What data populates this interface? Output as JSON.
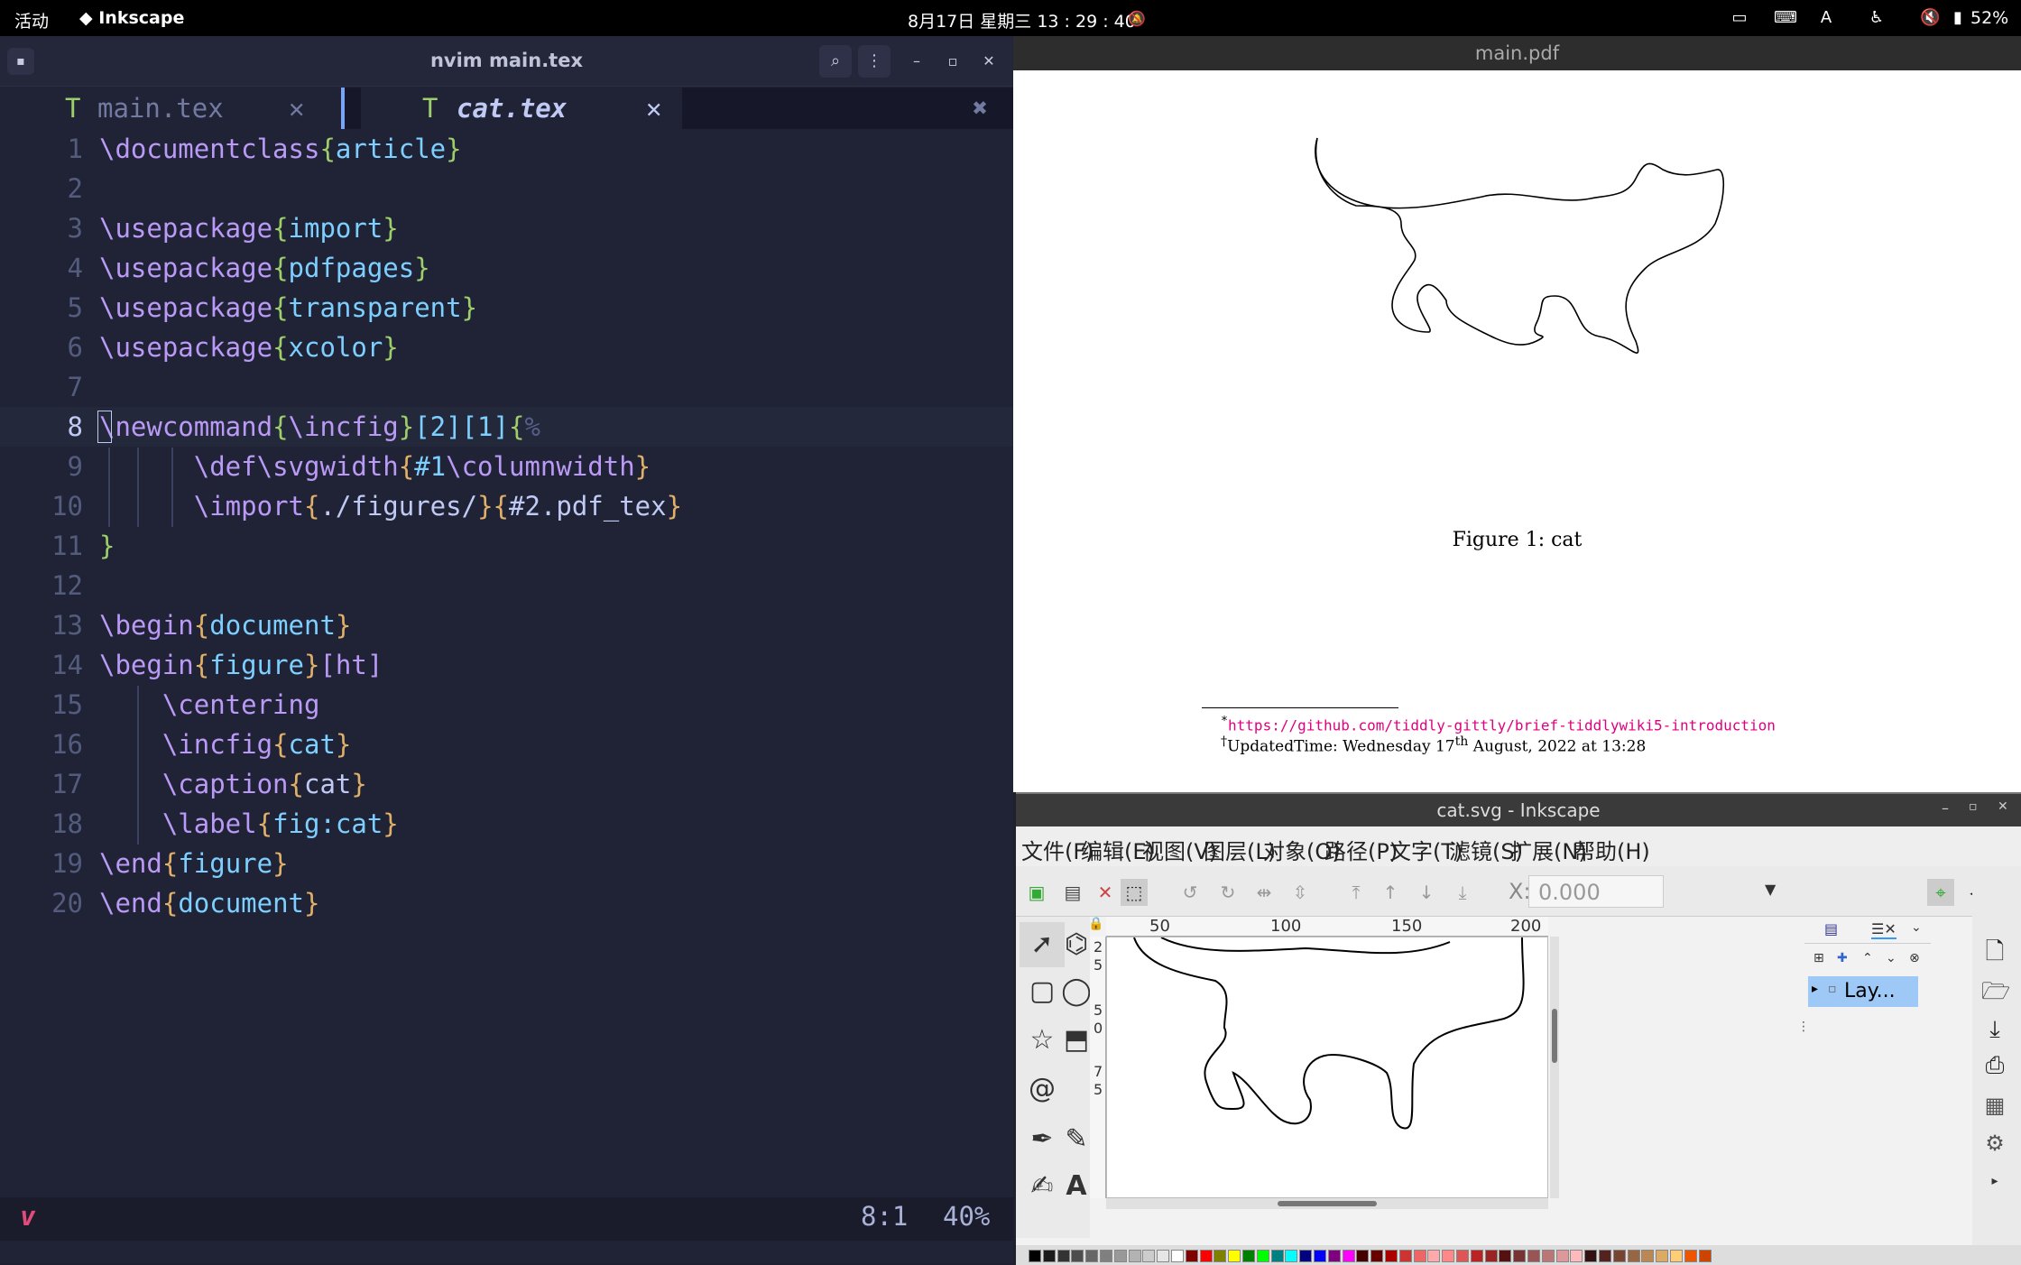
{
  "topbar": {
    "activities": "活动",
    "app": "Inkscape",
    "clock": "8月17日 星期三 13 : 29 : 40",
    "battery": "52%"
  },
  "nvim": {
    "title": "nvim main.tex",
    "tabs": [
      {
        "icon": "T",
        "label": "main.tex",
        "close": "✕"
      },
      {
        "icon": "T",
        "label": "cat.tex",
        "close": "✕"
      }
    ],
    "tab_close_all": "✖",
    "lines": [
      {
        "n": "1",
        "parts": [
          [
            "cmd",
            "\\documentclass"
          ],
          [
            "br",
            "{"
          ],
          [
            "arg",
            "article"
          ],
          [
            "br",
            "}"
          ]
        ]
      },
      {
        "n": "2",
        "parts": []
      },
      {
        "n": "3",
        "parts": [
          [
            "cmd",
            "\\usepackage"
          ],
          [
            "br",
            "{"
          ],
          [
            "arg",
            "import"
          ],
          [
            "br",
            "}"
          ]
        ]
      },
      {
        "n": "4",
        "parts": [
          [
            "cmd",
            "\\usepackage"
          ],
          [
            "br",
            "{"
          ],
          [
            "arg",
            "pdfpages"
          ],
          [
            "br",
            "}"
          ]
        ]
      },
      {
        "n": "5",
        "parts": [
          [
            "cmd",
            "\\usepackage"
          ],
          [
            "br",
            "{"
          ],
          [
            "arg",
            "transparent"
          ],
          [
            "br",
            "}"
          ]
        ]
      },
      {
        "n": "6",
        "parts": [
          [
            "cmd",
            "\\usepackage"
          ],
          [
            "br",
            "{"
          ],
          [
            "arg",
            "xcolor"
          ],
          [
            "br",
            "}"
          ]
        ]
      },
      {
        "n": "7",
        "parts": []
      },
      {
        "n": "8",
        "parts": [
          [
            "cmd",
            "\\newcommand"
          ],
          [
            "br",
            "{"
          ],
          [
            "cmd",
            "\\incfig"
          ],
          [
            "br",
            "}"
          ],
          [
            "num",
            "[2][1]"
          ],
          [
            "br",
            "{"
          ],
          [
            "cm",
            "%"
          ]
        ]
      },
      {
        "n": "9",
        "parts": [
          [
            "op",
            "      "
          ],
          [
            "cmd",
            "\\def"
          ],
          [
            "cmd",
            "\\svgwidth"
          ],
          [
            "br2",
            "{"
          ],
          [
            "num",
            "#1"
          ],
          [
            "cmd",
            "\\columnwidth"
          ],
          [
            "br2",
            "}"
          ]
        ]
      },
      {
        "n": "10",
        "parts": [
          [
            "op",
            "      "
          ],
          [
            "cmd",
            "\\import"
          ],
          [
            "br2",
            "{"
          ],
          [
            "op",
            "./figures/"
          ],
          [
            "br2",
            "}{"
          ],
          [
            "op",
            "#2.pdf_tex"
          ],
          [
            "br2",
            "}"
          ]
        ]
      },
      {
        "n": "11",
        "parts": [
          [
            "br",
            "}"
          ]
        ]
      },
      {
        "n": "12",
        "parts": []
      },
      {
        "n": "13",
        "parts": [
          [
            "cmd",
            "\\begin"
          ],
          [
            "br2",
            "{"
          ],
          [
            "arg",
            "document"
          ],
          [
            "br2",
            "}"
          ]
        ]
      },
      {
        "n": "14",
        "parts": [
          [
            "cmd",
            "\\begin"
          ],
          [
            "br2",
            "{"
          ],
          [
            "arg",
            "figure"
          ],
          [
            "br2",
            "}"
          ],
          [
            "cmd",
            "[ht]"
          ]
        ]
      },
      {
        "n": "15",
        "parts": [
          [
            "op",
            "    "
          ],
          [
            "cmd",
            "\\centering"
          ]
        ]
      },
      {
        "n": "16",
        "parts": [
          [
            "op",
            "    "
          ],
          [
            "cmd",
            "\\incfig"
          ],
          [
            "br2",
            "{"
          ],
          [
            "arg",
            "cat"
          ],
          [
            "br2",
            "}"
          ]
        ]
      },
      {
        "n": "17",
        "parts": [
          [
            "op",
            "    "
          ],
          [
            "cmd",
            "\\caption"
          ],
          [
            "br2",
            "{"
          ],
          [
            "op",
            "cat"
          ],
          [
            "br2",
            "}"
          ]
        ]
      },
      {
        "n": "18",
        "parts": [
          [
            "op",
            "    "
          ],
          [
            "cmd",
            "\\label"
          ],
          [
            "br2",
            "{"
          ],
          [
            "arg",
            "fig:cat"
          ],
          [
            "br2",
            "}"
          ]
        ]
      },
      {
        "n": "19",
        "parts": [
          [
            "cmd",
            "\\end"
          ],
          [
            "br2",
            "{"
          ],
          [
            "arg",
            "figure"
          ],
          [
            "br2",
            "}"
          ]
        ]
      },
      {
        "n": "20",
        "parts": [
          [
            "cmd",
            "\\end"
          ],
          [
            "br2",
            "{"
          ],
          [
            "arg",
            "document"
          ],
          [
            "br2",
            "}"
          ]
        ]
      }
    ],
    "status": {
      "mode_icon": "v",
      "pos": "8:1",
      "percent": "40%"
    }
  },
  "pdf": {
    "title": "main.pdf",
    "caption": "Figure 1: cat",
    "footnote1": "https://github.com/tiddly-gittly/brief-tiddlywiki5-introduction",
    "footnote2_prefix": "UpdatedTime: Wednesday 17",
    "footnote2_sup": "th",
    "footnote2_suffix": " August, 2022 at 13:28"
  },
  "inkscape": {
    "title": "cat.svg - Inkscape",
    "menu": [
      "文件(F)",
      "编辑(E)",
      "视图(V)",
      "图层(L)",
      "对象(O)",
      "路径(P)",
      "文字(T)",
      "滤镜(S)",
      "扩展(N)",
      "帮助(H)"
    ],
    "x_label": "X:",
    "x_value": "0.000",
    "ruler_h": [
      "50",
      "100",
      "150",
      "200"
    ],
    "ruler_v": [
      "2",
      "5",
      "5",
      "0",
      "7",
      "5"
    ],
    "layer_name": "Lay..."
  }
}
